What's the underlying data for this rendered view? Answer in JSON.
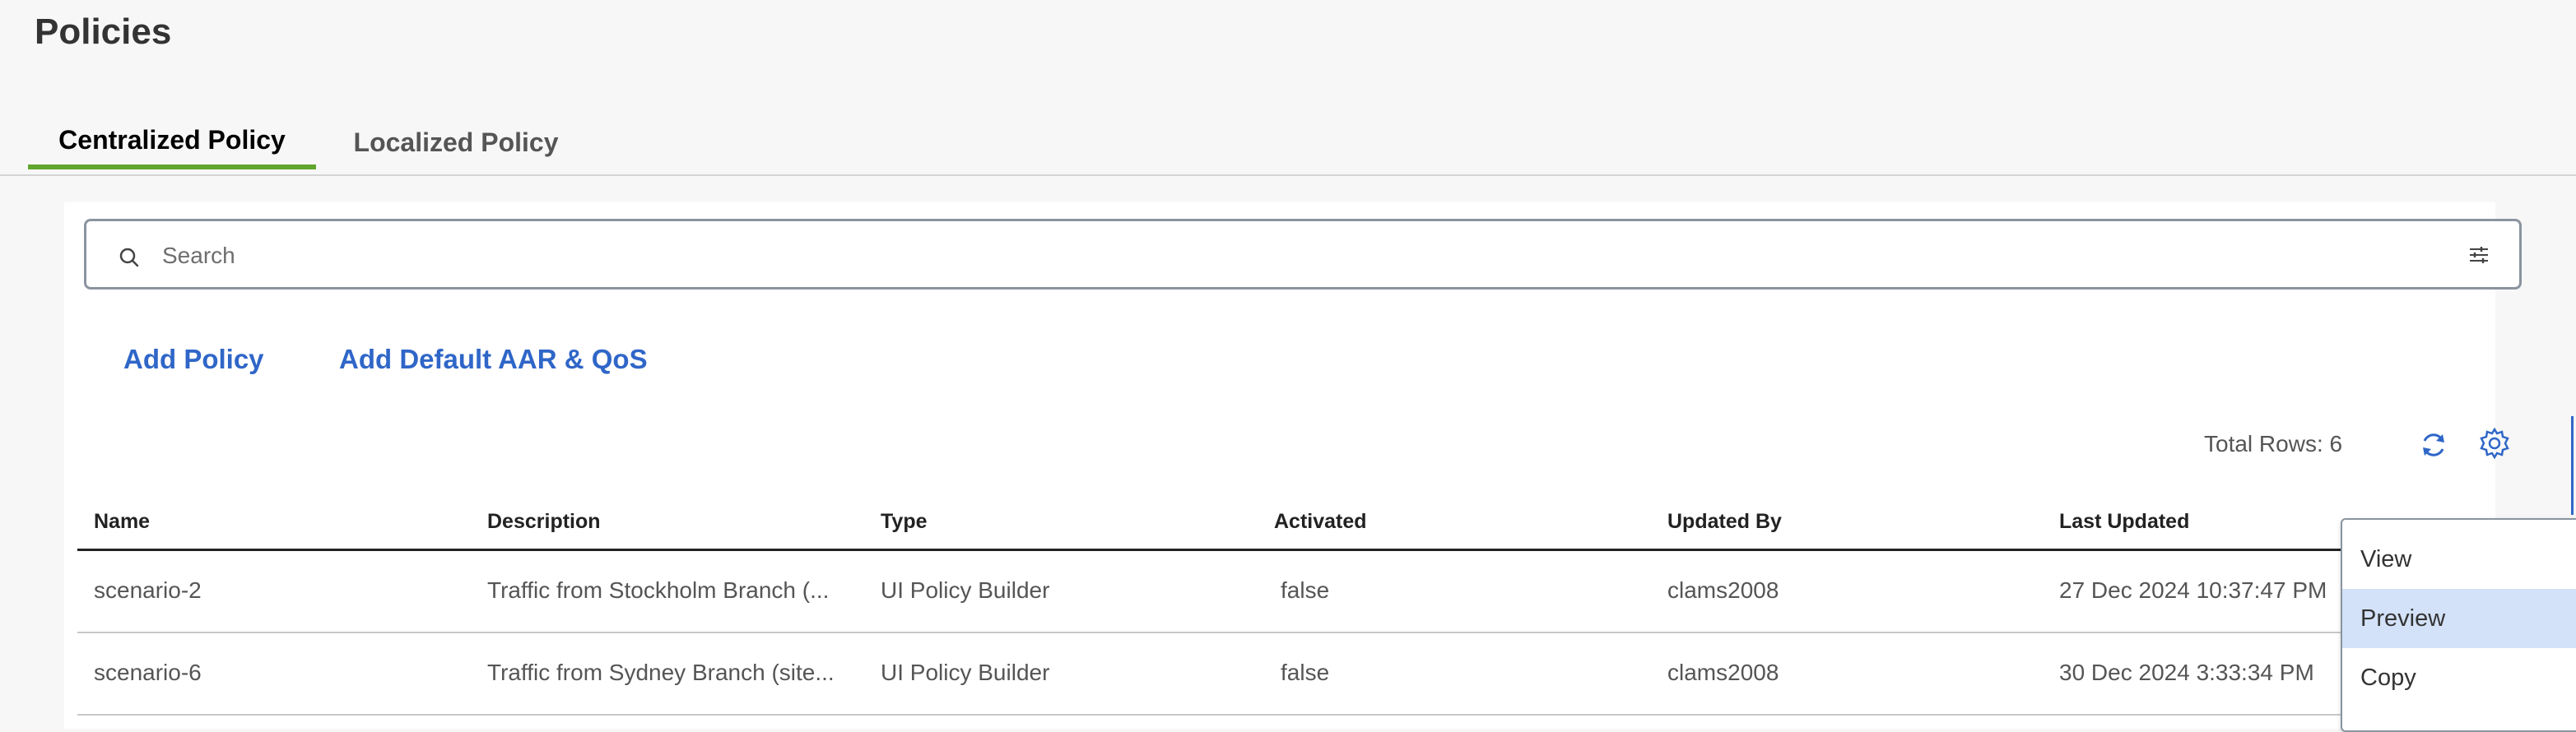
{
  "page": {
    "title": "Policies"
  },
  "tabs": [
    {
      "label": "Centralized Policy",
      "active": true
    },
    {
      "label": "Localized Policy",
      "active": false
    }
  ],
  "search": {
    "placeholder": "Search",
    "value": ""
  },
  "actions": {
    "add_policy": "Add Policy",
    "add_default": "Add Default AAR & QoS"
  },
  "table_meta": {
    "total_rows": "Total Rows: 6"
  },
  "table": {
    "columns": [
      "Name",
      "Description",
      "Type",
      "Activated",
      "Updated By",
      "Last Updated"
    ],
    "rows": [
      {
        "name": "scenario-2",
        "description": "Traffic from Stockholm Branch (...",
        "type": "UI Policy Builder",
        "activated": "false",
        "updated_by": "clams2008",
        "last_updated": "27 Dec 2024 10:37:47 PM"
      },
      {
        "name": "scenario-6",
        "description": "Traffic from Sydney Branch (site...",
        "type": "UI Policy Builder",
        "activated": "false",
        "updated_by": "clams2008",
        "last_updated": "30 Dec 2024 3:33:34 PM"
      }
    ]
  },
  "context_menu": {
    "items": [
      "View",
      "Preview",
      "Copy"
    ],
    "highlighted": "Preview"
  },
  "icons": {
    "search": "search-icon",
    "filter": "filter-sliders-icon",
    "refresh": "refresh-icon",
    "settings": "gear-icon"
  },
  "colors": {
    "accent": "#2f66c8",
    "active_tab_underline": "#5fa52e",
    "menu_highlight": "#d3e2f8"
  }
}
